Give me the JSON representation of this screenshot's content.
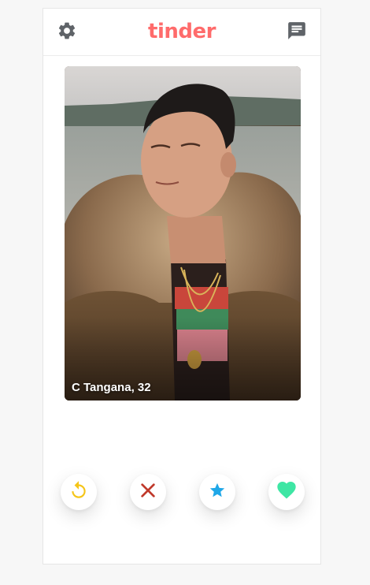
{
  "header": {
    "logo_text": "tinder",
    "settings_icon": "gear-icon",
    "messages_icon": "chat-icon"
  },
  "card": {
    "caption": "C Tangana, 32"
  },
  "actions": [
    {
      "name": "rewind",
      "icon": "rewind-icon",
      "color": "#f5c518"
    },
    {
      "name": "nope",
      "icon": "close-icon",
      "color": "#c0392b"
    },
    {
      "name": "super-like",
      "icon": "star-icon",
      "color": "#1fa7e8"
    },
    {
      "name": "like",
      "icon": "heart-icon",
      "color": "#3ee6a4"
    }
  ],
  "colors": {
    "brand": "#ff6b6b",
    "page_bg": "#f7f7f7",
    "card_bg": "#ffffff"
  }
}
